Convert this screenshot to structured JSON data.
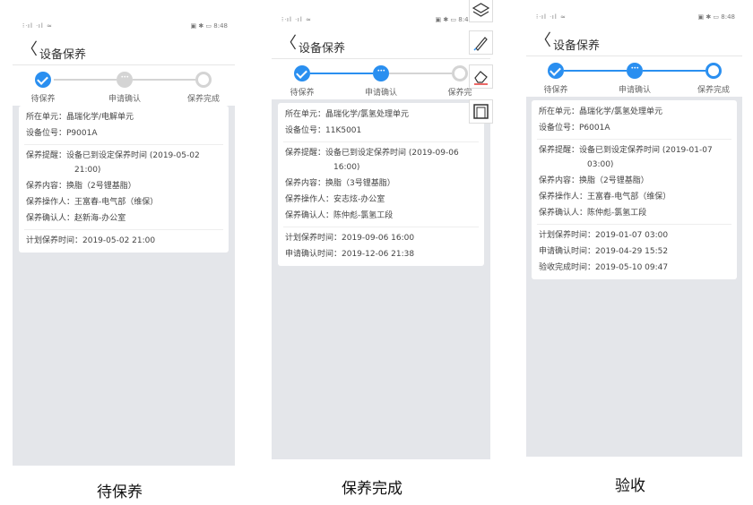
{
  "status_bar": {
    "left": "⁝ᐧıl ᐧıl ≈",
    "right": "▣ ✱ ▭ 8:48"
  },
  "phones": [
    {
      "back_glyph": "〈",
      "title": "设备保养",
      "steps": [
        "待保养",
        "申请确认",
        "保养完成"
      ],
      "fields": {
        "unit": "所在单元：晶瑞化学/电解单元",
        "position": "设备位号：P9001A",
        "reminder": "保养提醒：设备已到设定保养时间 (2019-05-02",
        "reminder_cont": "21:00)",
        "content": "保养内容：换脂（2号锂基脂）",
        "operator": "保养操作人：王富春-电气部（维保）",
        "confirmer": "保养确认人：赵新海-办公室",
        "plan_time": "计划保养时间：2019-05-02 21:00"
      },
      "caption": "待保养"
    },
    {
      "back_glyph": "〈",
      "title": "设备保养",
      "steps": [
        "待保养",
        "申请确认",
        "保养完"
      ],
      "fields": {
        "unit": "所在单元：晶瑞化学/氯氢处理单元",
        "position": "设备位号：11K5001",
        "reminder": "保养提醒：设备已到设定保养时间 (2019-09-06",
        "reminder_cont": "16:00)",
        "content": "保养内容：换脂（3号锂基脂）",
        "operator": "保养操作人：安志炫-办公室",
        "confirmer": "保养确认人：陈仲彪-氯氢工段",
        "plan_time": "计划保养时间：2019-09-06 16:00",
        "apply_time": "申请确认时间：2019-12-06 21:38"
      },
      "caption": "保养完成"
    },
    {
      "back_glyph": "〈",
      "title": "设备保养",
      "steps": [
        "待保养",
        "申请确认",
        "保养完成"
      ],
      "fields": {
        "unit": "所在单元：晶瑞化学/氯氢处理单元",
        "position": "设备位号：P6001A",
        "reminder": "保养提醒：设备已到设定保养时间 (2019-01-07",
        "reminder_cont": "03:00)",
        "content": "保养内容：换脂（2号锂基脂）",
        "operator": "保养操作人：王富春-电气部（维保）",
        "confirmer": "保养确认人：陈仲彪-氯氢工段",
        "plan_time": "计划保养时间：2019-01-07 03:00",
        "apply_time": "申请确认时间：2019-04-29 15:52",
        "accept_time": "验收完成时间：2019-05-10 09:47"
      },
      "caption": "验收"
    }
  ],
  "toolbar": [
    "layers-icon",
    "pen-icon",
    "eraser-icon",
    "frame-icon"
  ],
  "colors": {
    "accent": "#2a8ff0",
    "inactive": "#d4d4d4",
    "background": "#e4e6ea"
  }
}
